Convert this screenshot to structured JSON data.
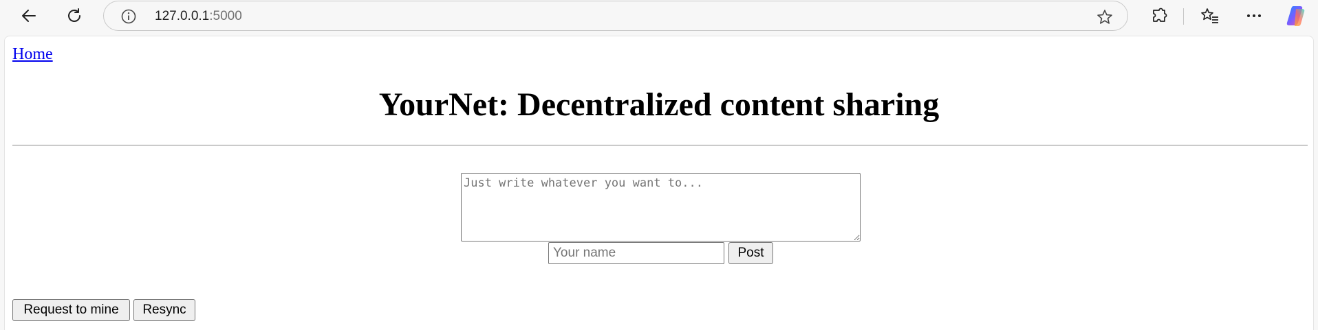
{
  "browser": {
    "url_host": "127.0.0.1",
    "url_port": ":5000",
    "icons": [
      "back-icon",
      "reload-icon",
      "info-icon",
      "star-icon",
      "extensions-icon",
      "favorites-icon",
      "more-icon",
      "copilot-icon"
    ]
  },
  "page": {
    "home_link": "Home",
    "title": "YourNet: Decentralized content sharing",
    "post_form": {
      "body_placeholder": "Just write whatever you want to...",
      "body_value": "",
      "name_placeholder": "Your name",
      "name_value": "",
      "post_label": "Post"
    },
    "actions": {
      "request_mine_label": "Request to mine",
      "resync_label": "Resync"
    }
  }
}
